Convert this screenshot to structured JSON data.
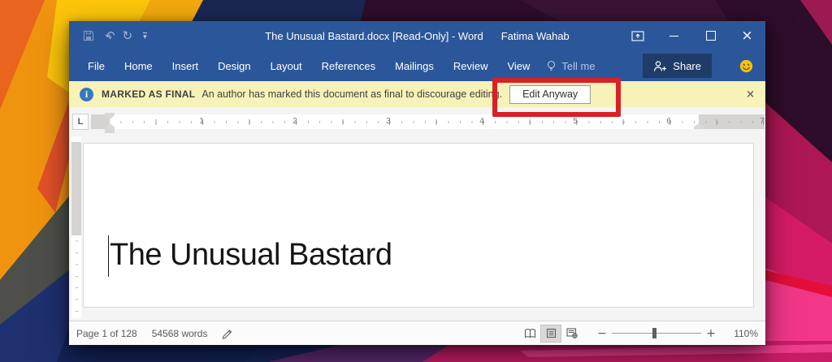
{
  "titlebar": {
    "title": "The Unusual Bastard.docx [Read-Only] - Word",
    "user": "Fatima Wahab"
  },
  "icons": {
    "undo": "↶",
    "redo": "↻",
    "qat_more": "▾",
    "close": "×",
    "banner_close": "×",
    "zoom_out": "−",
    "zoom_in": "+"
  },
  "menubar": {
    "tabs": [
      "File",
      "Home",
      "Insert",
      "Design",
      "Layout",
      "References",
      "Mailings",
      "Review",
      "View"
    ],
    "tell_me": "Tell me",
    "share": "Share"
  },
  "infobar": {
    "label": "MARKED AS FINAL",
    "message": "An author has marked this document as final to discourage editing.",
    "info_glyph": "i",
    "button": "Edit Anyway"
  },
  "ruler": {
    "tab_selector": "L",
    "numbers": [
      "1",
      "2",
      "3",
      "4",
      "5",
      "6",
      "7"
    ]
  },
  "document": {
    "heading": "The Unusual Bastard"
  },
  "statusbar": {
    "page": "Page 1 of 128",
    "words": "54568 words",
    "zoom_level": "110%"
  },
  "colors": {
    "accent_blue": "#2b579a",
    "share_dark": "#1f3c68",
    "banner_yellow": "#f7f2b8",
    "annotation_red": "#d92025",
    "smiley_yellow": "#f5c211"
  }
}
